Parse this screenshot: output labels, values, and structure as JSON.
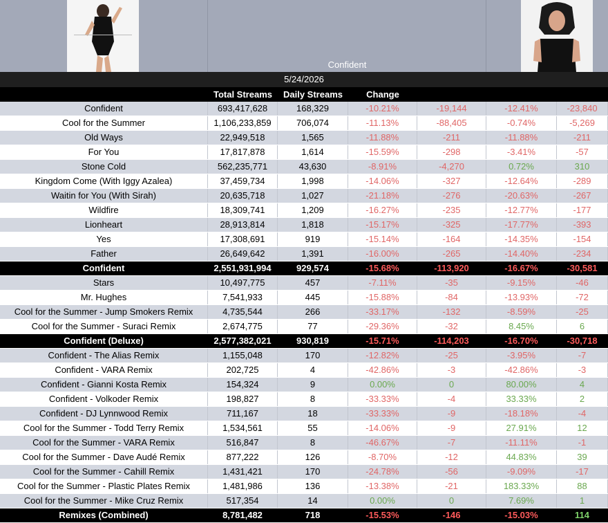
{
  "header": {
    "title": "Confident",
    "date": "5/24/2026"
  },
  "columns": {
    "total_streams": "Total Streams",
    "daily_streams": "Daily Streams",
    "change": "Change"
  },
  "colors": {
    "header_bg": "#a3a9b8",
    "row_alt": "#d3d7e0",
    "negative": "#e06666",
    "positive": "#6aa84f"
  },
  "rows": [
    {
      "name": "Confident",
      "total": "693,417,628",
      "daily": "168,329",
      "pct1": "-10.21%",
      "abs1": "-19,144",
      "pct2": "-12.41%",
      "abs2": "-23,840",
      "type": "odd"
    },
    {
      "name": "Cool for the Summer",
      "total": "1,106,233,859",
      "daily": "706,074",
      "pct1": "-11.13%",
      "abs1": "-88,405",
      "pct2": "-0.74%",
      "abs2": "-5,269",
      "type": "even"
    },
    {
      "name": "Old Ways",
      "total": "22,949,518",
      "daily": "1,565",
      "pct1": "-11.88%",
      "abs1": "-211",
      "pct2": "-11.88%",
      "abs2": "-211",
      "type": "odd"
    },
    {
      "name": "For You",
      "total": "17,817,878",
      "daily": "1,614",
      "pct1": "-15.59%",
      "abs1": "-298",
      "pct2": "-3.41%",
      "abs2": "-57",
      "type": "even"
    },
    {
      "name": "Stone Cold",
      "total": "562,235,771",
      "daily": "43,630",
      "pct1": "-8.91%",
      "abs1": "-4,270",
      "pct2": "0.72%",
      "abs2": "310",
      "type": "odd"
    },
    {
      "name": "Kingdom Come (With Iggy Azalea)",
      "total": "37,459,734",
      "daily": "1,998",
      "pct1": "-14.06%",
      "abs1": "-327",
      "pct2": "-12.64%",
      "abs2": "-289",
      "type": "even"
    },
    {
      "name": "Waitin for You (With Sirah)",
      "total": "20,635,718",
      "daily": "1,027",
      "pct1": "-21.18%",
      "abs1": "-276",
      "pct2": "-20.63%",
      "abs2": "-267",
      "type": "odd"
    },
    {
      "name": "Wildfire",
      "total": "18,309,741",
      "daily": "1,209",
      "pct1": "-16.27%",
      "abs1": "-235",
      "pct2": "-12.77%",
      "abs2": "-177",
      "type": "even"
    },
    {
      "name": "Lionheart",
      "total": "28,913,814",
      "daily": "1,818",
      "pct1": "-15.17%",
      "abs1": "-325",
      "pct2": "-17.77%",
      "abs2": "-393",
      "type": "odd"
    },
    {
      "name": "Yes",
      "total": "17,308,691",
      "daily": "919",
      "pct1": "-15.14%",
      "abs1": "-164",
      "pct2": "-14.35%",
      "abs2": "-154",
      "type": "even"
    },
    {
      "name": "Father",
      "total": "26,649,642",
      "daily": "1,391",
      "pct1": "-16.00%",
      "abs1": "-265",
      "pct2": "-14.40%",
      "abs2": "-234",
      "type": "odd"
    },
    {
      "name": "Confident",
      "total": "2,551,931,994",
      "daily": "929,574",
      "pct1": "-15.68%",
      "abs1": "-113,920",
      "pct2": "-16.67%",
      "abs2": "-30,581",
      "type": "total"
    },
    {
      "name": "Stars",
      "total": "10,497,775",
      "daily": "457",
      "pct1": "-7.11%",
      "abs1": "-35",
      "pct2": "-9.15%",
      "abs2": "-46",
      "type": "odd"
    },
    {
      "name": "Mr. Hughes",
      "total": "7,541,933",
      "daily": "445",
      "pct1": "-15.88%",
      "abs1": "-84",
      "pct2": "-13.93%",
      "abs2": "-72",
      "type": "even"
    },
    {
      "name": "Cool for the Summer - Jump Smokers Remix",
      "total": "4,735,544",
      "daily": "266",
      "pct1": "-33.17%",
      "abs1": "-132",
      "pct2": "-8.59%",
      "abs2": "-25",
      "type": "odd"
    },
    {
      "name": "Cool for the Summer - Suraci Remix",
      "total": "2,674,775",
      "daily": "77",
      "pct1": "-29.36%",
      "abs1": "-32",
      "pct2": "8.45%",
      "abs2": "6",
      "type": "even"
    },
    {
      "name": "Confident (Deluxe)",
      "total": "2,577,382,021",
      "daily": "930,819",
      "pct1": "-15.71%",
      "abs1": "-114,203",
      "pct2": "-16.70%",
      "abs2": "-30,718",
      "type": "total"
    },
    {
      "name": "Confident - The Alias Remix",
      "total": "1,155,048",
      "daily": "170",
      "pct1": "-12.82%",
      "abs1": "-25",
      "pct2": "-3.95%",
      "abs2": "-7",
      "type": "odd"
    },
    {
      "name": "Confident - VARA Remix",
      "total": "202,725",
      "daily": "4",
      "pct1": "-42.86%",
      "abs1": "-3",
      "pct2": "-42.86%",
      "abs2": "-3",
      "type": "even"
    },
    {
      "name": "Confident - Gianni Kosta Remix",
      "total": "154,324",
      "daily": "9",
      "pct1": "0.00%",
      "abs1": "0",
      "pct2": "80.00%",
      "abs2": "4",
      "type": "odd"
    },
    {
      "name": "Confident - Volkoder Remix",
      "total": "198,827",
      "daily": "8",
      "pct1": "-33.33%",
      "abs1": "-4",
      "pct2": "33.33%",
      "abs2": "2",
      "type": "even"
    },
    {
      "name": "Confident - DJ Lynnwood Remix",
      "total": "711,167",
      "daily": "18",
      "pct1": "-33.33%",
      "abs1": "-9",
      "pct2": "-18.18%",
      "abs2": "-4",
      "type": "odd"
    },
    {
      "name": "Cool for the Summer - Todd Terry Remix",
      "total": "1,534,561",
      "daily": "55",
      "pct1": "-14.06%",
      "abs1": "-9",
      "pct2": "27.91%",
      "abs2": "12",
      "type": "even"
    },
    {
      "name": "Cool for the Summer - VARA Remix",
      "total": "516,847",
      "daily": "8",
      "pct1": "-46.67%",
      "abs1": "-7",
      "pct2": "-11.11%",
      "abs2": "-1",
      "type": "odd"
    },
    {
      "name": "Cool for the Summer - Dave Audé Remix",
      "total": "877,222",
      "daily": "126",
      "pct1": "-8.70%",
      "abs1": "-12",
      "pct2": "44.83%",
      "abs2": "39",
      "type": "even"
    },
    {
      "name": "Cool for the Summer - Cahill Remix",
      "total": "1,431,421",
      "daily": "170",
      "pct1": "-24.78%",
      "abs1": "-56",
      "pct2": "-9.09%",
      "abs2": "-17",
      "type": "odd"
    },
    {
      "name": "Cool for the Summer - Plastic Plates Remix",
      "total": "1,481,986",
      "daily": "136",
      "pct1": "-13.38%",
      "abs1": "-21",
      "pct2": "183.33%",
      "abs2": "88",
      "type": "even"
    },
    {
      "name": "Cool for the Summer - Mike Cruz Remix",
      "total": "517,354",
      "daily": "14",
      "pct1": "0.00%",
      "abs1": "0",
      "pct2": "7.69%",
      "abs2": "1",
      "type": "odd"
    },
    {
      "name": "Remixes (Combined)",
      "total": "8,781,482",
      "daily": "718",
      "pct1": "-15.53%",
      "abs1": "-146",
      "pct2": "-15.03%",
      "abs2": "114",
      "type": "total"
    }
  ]
}
